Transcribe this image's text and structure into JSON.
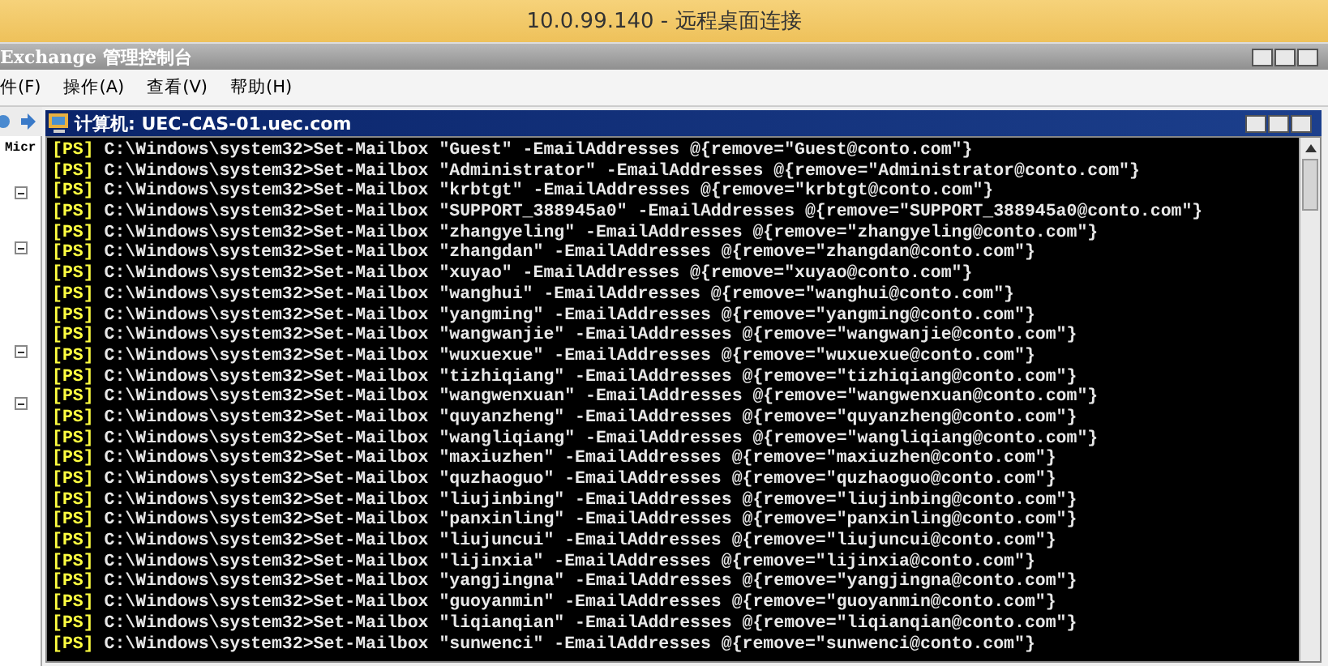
{
  "rdp_window": {
    "title": "10.0.99.140 - 远程桌面连接"
  },
  "mmc_window": {
    "title": "Exchange 管理控制台"
  },
  "menu": [
    "件(F)",
    "操作(A)",
    "查看(V)",
    "帮助(H)"
  ],
  "tree": {
    "label": "Micr"
  },
  "console_window": {
    "title": "计算机: UEC-CAS-01.uec.com"
  },
  "console_lines": [
    {
      "prompt": "[PS]",
      "command": "C:\\Windows\\system32>Set-Mailbox \"Guest\" -EmailAddresses @{remove=\"Guest@conto.com\"}"
    },
    {
      "prompt": "[PS]",
      "command": "C:\\Windows\\system32>Set-Mailbox \"Administrator\" -EmailAddresses @{remove=\"Administrator@conto.com\"}"
    },
    {
      "prompt": "[PS]",
      "command": "C:\\Windows\\system32>Set-Mailbox \"krbtgt\" -EmailAddresses @{remove=\"krbtgt@conto.com\"}"
    },
    {
      "prompt": "[PS]",
      "command": "C:\\Windows\\system32>Set-Mailbox \"SUPPORT_388945a0\" -EmailAddresses @{remove=\"SUPPORT_388945a0@conto.com\"}"
    },
    {
      "prompt": "[PS]",
      "command": "C:\\Windows\\system32>Set-Mailbox \"zhangyeling\" -EmailAddresses @{remove=\"zhangyeling@conto.com\"}"
    },
    {
      "prompt": "[PS]",
      "command": "C:\\Windows\\system32>Set-Mailbox \"zhangdan\" -EmailAddresses @{remove=\"zhangdan@conto.com\"}"
    },
    {
      "prompt": "[PS]",
      "command": "C:\\Windows\\system32>Set-Mailbox \"xuyao\" -EmailAddresses @{remove=\"xuyao@conto.com\"}"
    },
    {
      "prompt": "[PS]",
      "command": "C:\\Windows\\system32>Set-Mailbox \"wanghui\" -EmailAddresses @{remove=\"wanghui@conto.com\"}"
    },
    {
      "prompt": "[PS]",
      "command": "C:\\Windows\\system32>Set-Mailbox \"yangming\" -EmailAddresses @{remove=\"yangming@conto.com\"}"
    },
    {
      "prompt": "[PS]",
      "command": "C:\\Windows\\system32>Set-Mailbox \"wangwanjie\" -EmailAddresses @{remove=\"wangwanjie@conto.com\"}"
    },
    {
      "prompt": "[PS]",
      "command": "C:\\Windows\\system32>Set-Mailbox \"wuxuexue\" -EmailAddresses @{remove=\"wuxuexue@conto.com\"}"
    },
    {
      "prompt": "[PS]",
      "command": "C:\\Windows\\system32>Set-Mailbox \"tizhiqiang\" -EmailAddresses @{remove=\"tizhiqiang@conto.com\"}"
    },
    {
      "prompt": "[PS]",
      "command": "C:\\Windows\\system32>Set-Mailbox \"wangwenxuan\" -EmailAddresses @{remove=\"wangwenxuan@conto.com\"}"
    },
    {
      "prompt": "[PS]",
      "command": "C:\\Windows\\system32>Set-Mailbox \"quyanzheng\" -EmailAddresses @{remove=\"quyanzheng@conto.com\"}"
    },
    {
      "prompt": "[PS]",
      "command": "C:\\Windows\\system32>Set-Mailbox \"wangliqiang\" -EmailAddresses @{remove=\"wangliqiang@conto.com\"}"
    },
    {
      "prompt": "[PS]",
      "command": "C:\\Windows\\system32>Set-Mailbox \"maxiuzhen\" -EmailAddresses @{remove=\"maxiuzhen@conto.com\"}"
    },
    {
      "prompt": "[PS]",
      "command": "C:\\Windows\\system32>Set-Mailbox \"quzhaoguo\" -EmailAddresses @{remove=\"quzhaoguo@conto.com\"}"
    },
    {
      "prompt": "[PS]",
      "command": "C:\\Windows\\system32>Set-Mailbox \"liujinbing\" -EmailAddresses @{remove=\"liujinbing@conto.com\"}"
    },
    {
      "prompt": "[PS]",
      "command": "C:\\Windows\\system32>Set-Mailbox \"panxinling\" -EmailAddresses @{remove=\"panxinling@conto.com\"}"
    },
    {
      "prompt": "[PS]",
      "command": "C:\\Windows\\system32>Set-Mailbox \"liujuncui\" -EmailAddresses @{remove=\"liujuncui@conto.com\"}"
    },
    {
      "prompt": "[PS]",
      "command": "C:\\Windows\\system32>Set-Mailbox \"lijinxia\" -EmailAddresses @{remove=\"lijinxia@conto.com\"}"
    },
    {
      "prompt": "[PS]",
      "command": "C:\\Windows\\system32>Set-Mailbox \"yangjingna\" -EmailAddresses @{remove=\"yangjingna@conto.com\"}"
    },
    {
      "prompt": "[PS]",
      "command": "C:\\Windows\\system32>Set-Mailbox \"guoyanmin\" -EmailAddresses @{remove=\"guoyanmin@conto.com\"}"
    },
    {
      "prompt": "[PS]",
      "command": "C:\\Windows\\system32>Set-Mailbox \"liqianqian\" -EmailAddresses @{remove=\"liqianqian@conto.com\"}"
    },
    {
      "prompt": "[PS]",
      "command": "C:\\Windows\\system32>Set-Mailbox \"sunwenci\" -EmailAddresses @{remove=\"sunwenci@conto.com\"}"
    }
  ]
}
